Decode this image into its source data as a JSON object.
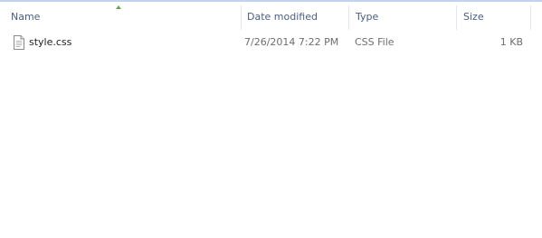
{
  "columns": {
    "name": "Name",
    "date_modified": "Date modified",
    "type": "Type",
    "size": "Size"
  },
  "sort": {
    "column": "name",
    "direction": "ascending"
  },
  "files": [
    {
      "name": "style.css",
      "date_modified": "7/26/2014 7:22 PM",
      "type": "CSS File",
      "size": "1 KB",
      "icon": "document-icon"
    }
  ],
  "colors": {
    "header_text": "#4c607a",
    "detail_text": "#6d6d6d",
    "sort_arrow": "#6e9f5a",
    "top_border": "#c4d3e7"
  }
}
